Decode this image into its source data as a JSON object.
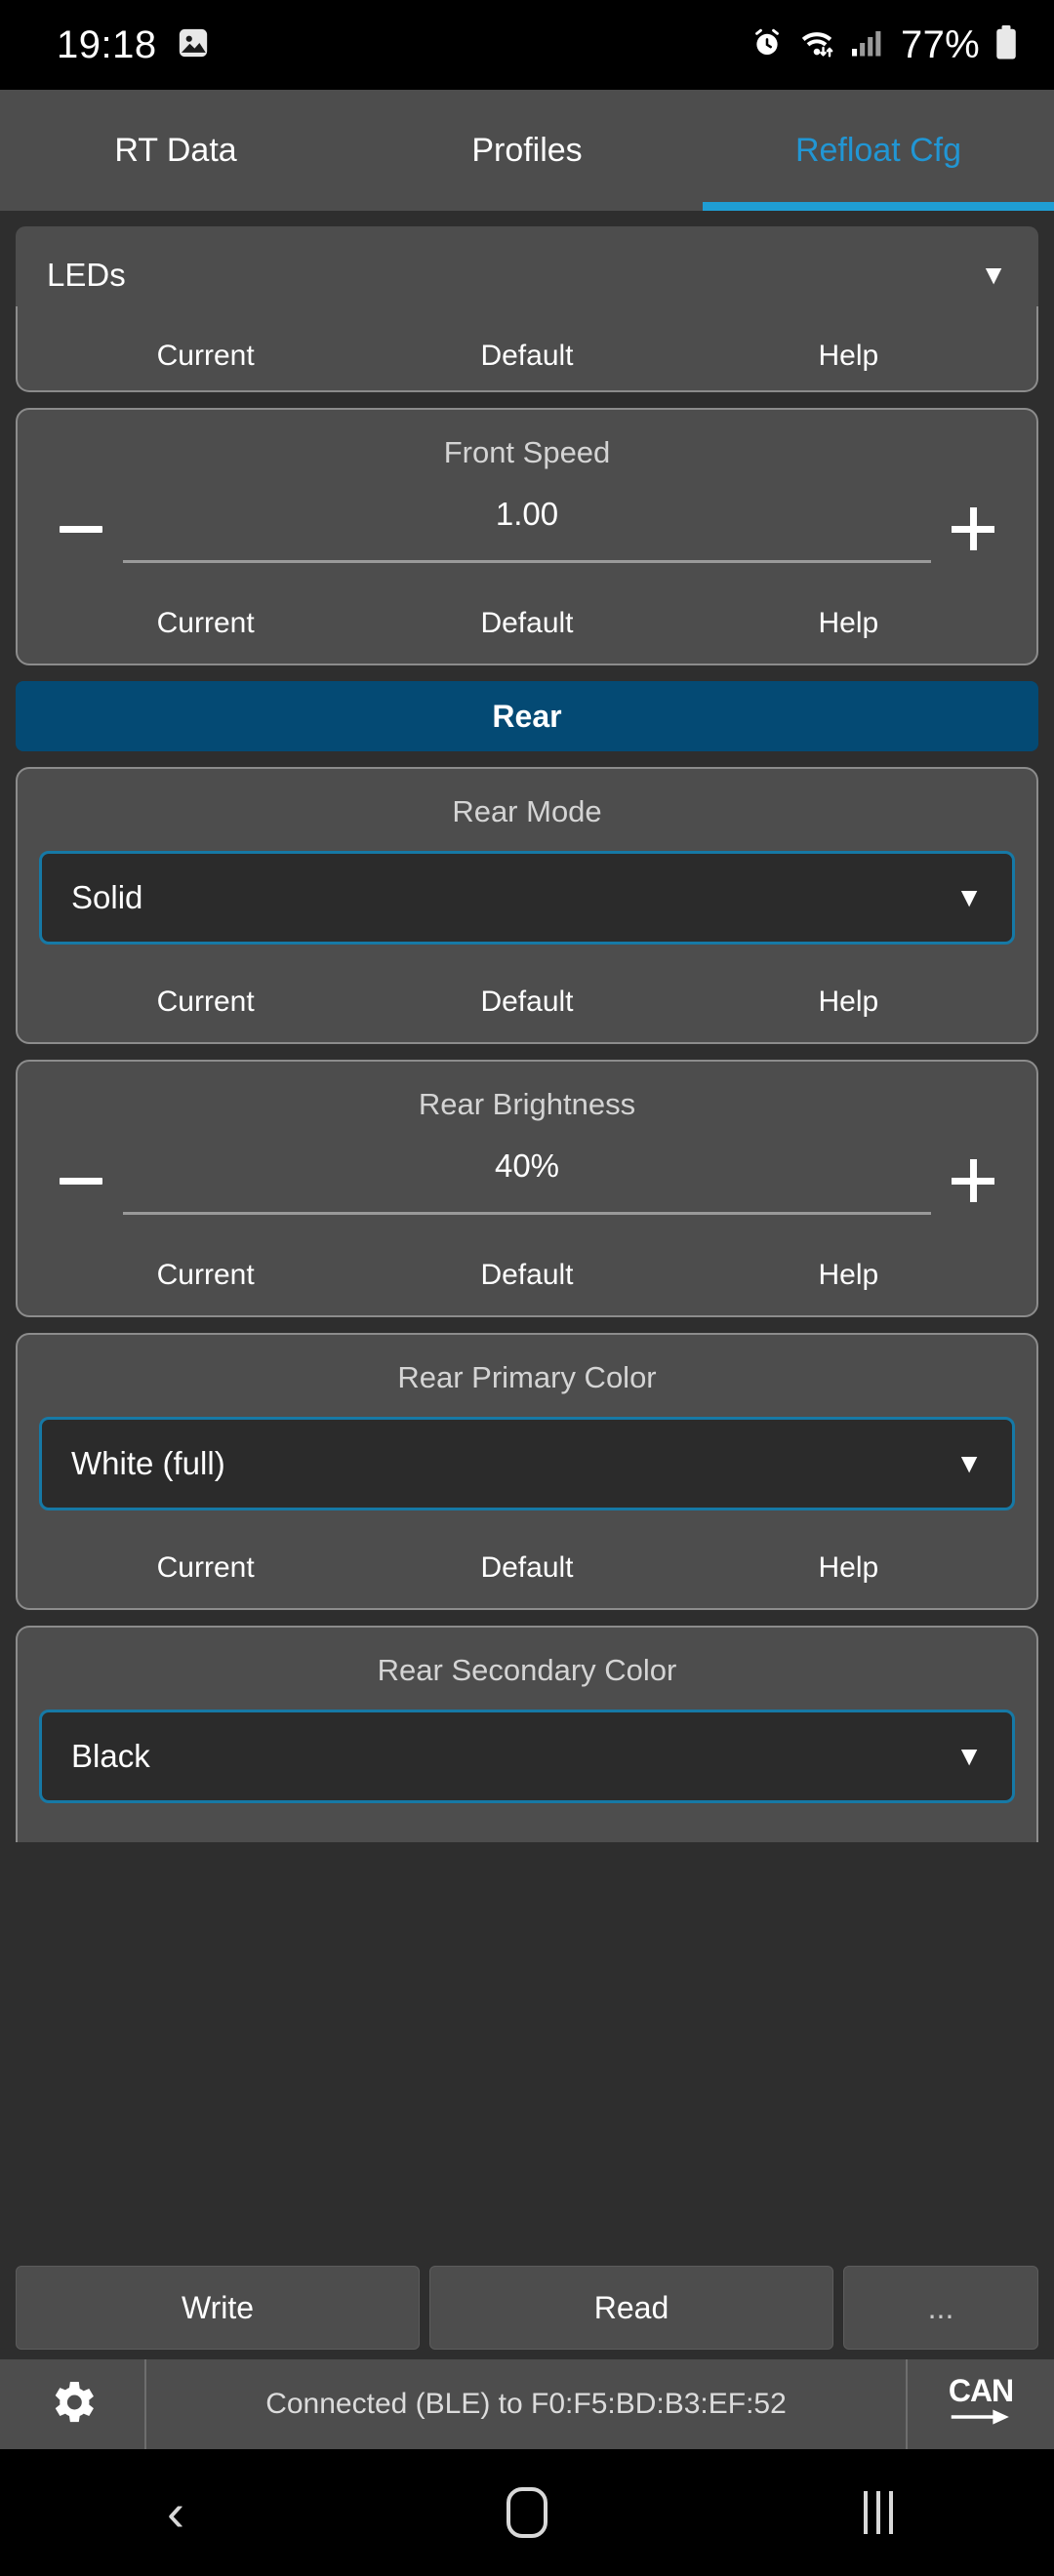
{
  "statusbar": {
    "time": "19:18",
    "battery_percent": "77%",
    "icons": [
      "screenshot-image-icon",
      "alarm-icon",
      "wifi-icon",
      "signal-icon",
      "battery-icon"
    ]
  },
  "tabs": [
    {
      "label": "RT Data",
      "active": false
    },
    {
      "label": "Profiles",
      "active": false
    },
    {
      "label": "Refloat Cfg",
      "active": true
    }
  ],
  "selector": {
    "value": "LEDs",
    "caret": "▼"
  },
  "links": {
    "current": "Current",
    "default": "Default",
    "help": "Help"
  },
  "cards": {
    "clipped": {
      "title": ""
    },
    "front_speed": {
      "title": "Front Speed",
      "value": "1.00",
      "minus": "−",
      "plus": "+"
    },
    "rear_mode": {
      "title": "Rear Mode",
      "value": "Solid",
      "caret": "▼"
    },
    "rear_brightness": {
      "title": "Rear Brightness",
      "value": "40%",
      "minus": "−",
      "plus": "+"
    },
    "rear_primary": {
      "title": "Rear Primary Color",
      "value": "White (full)",
      "caret": "▼"
    },
    "rear_secondary": {
      "title": "Rear Secondary Color",
      "value": "Black",
      "caret": "▼"
    }
  },
  "section_header": {
    "label": "Rear"
  },
  "actions": {
    "write": "Write",
    "read": "Read",
    "more": "..."
  },
  "bottombar": {
    "gear_icon": "gear-icon",
    "status": "Connected (BLE) to F0:F5:BD:B3:EF:52",
    "can_label": "CAN"
  },
  "navbar": {
    "back": "‹",
    "home": "home-icon",
    "recents": "recents-icon"
  },
  "colors": {
    "accent_tab": "#1f9ed4",
    "section_header": "#044a74",
    "combo_border": "#1679a6",
    "card_bg": "#4d4d4d",
    "page_bg": "#2e2e2e"
  }
}
